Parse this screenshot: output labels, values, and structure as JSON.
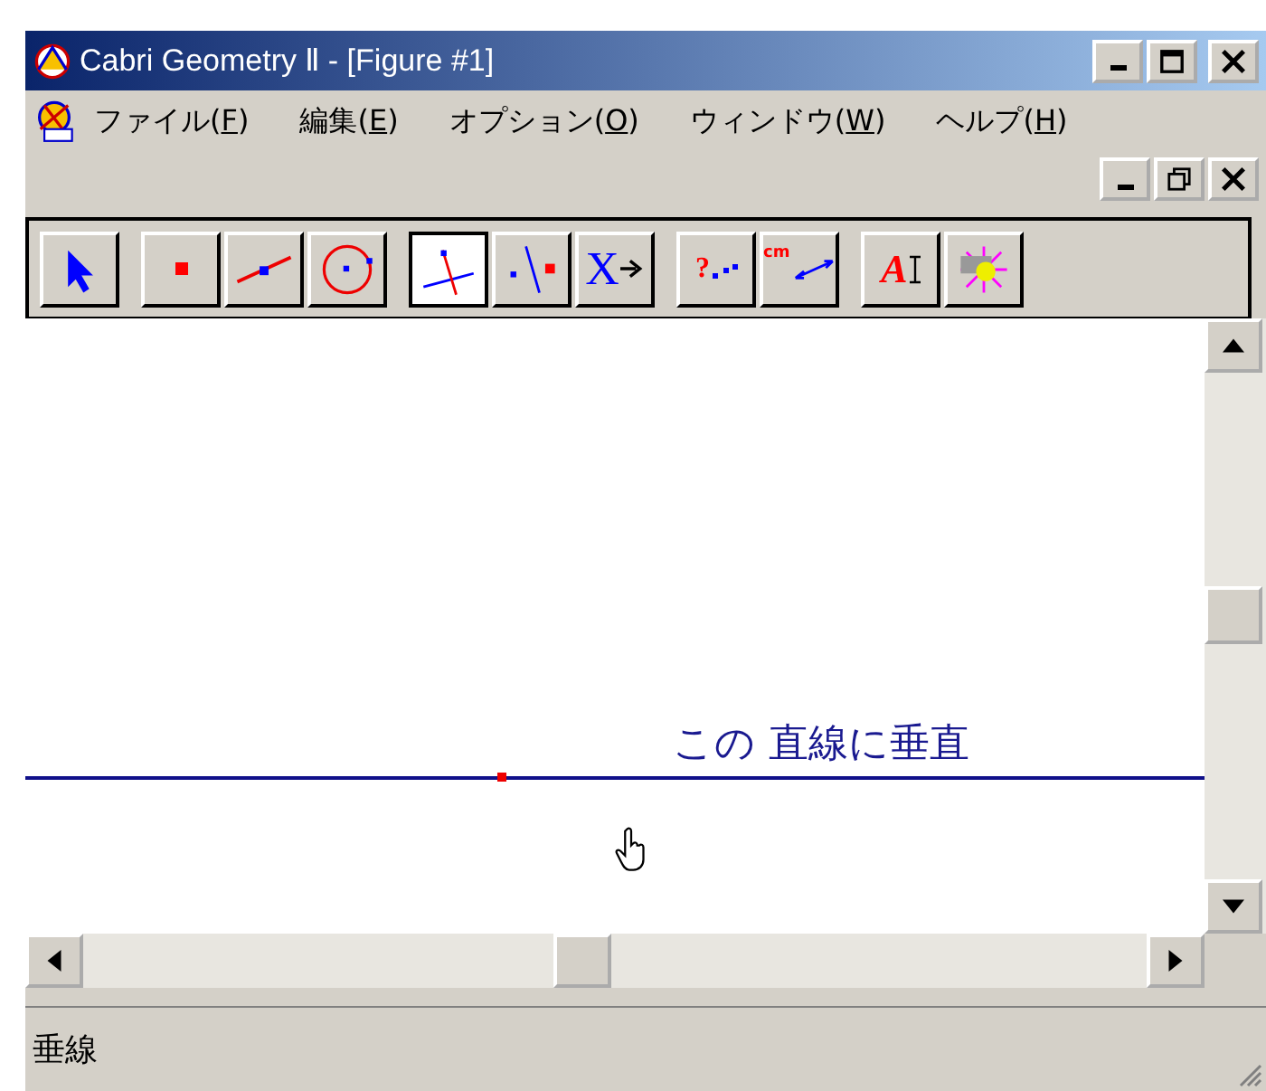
{
  "window": {
    "title": "Cabri Geometry Ⅱ - [Figure #1]"
  },
  "menu": [
    {
      "label": "ファイル(F)"
    },
    {
      "label": "編集(E)"
    },
    {
      "label": "オプション(O)"
    },
    {
      "label": "ウィンドウ(W)"
    },
    {
      "label": "ヘルプ(H)"
    }
  ],
  "toolbar": [
    {
      "kind": "pointer",
      "selected": false
    },
    {
      "kind": "point",
      "selected": false
    },
    {
      "kind": "line",
      "selected": false
    },
    {
      "kind": "circle",
      "selected": false
    },
    {
      "kind": "perpendicular",
      "selected": true
    },
    {
      "kind": "reflect",
      "selected": false
    },
    {
      "kind": "macro",
      "glyph": "X",
      "selected": false
    },
    {
      "kind": "check",
      "glyph": "?",
      "selected": false
    },
    {
      "kind": "measure",
      "glyph": "cm",
      "selected": false
    },
    {
      "kind": "text",
      "glyph": "A",
      "selected": false
    },
    {
      "kind": "display",
      "selected": false
    }
  ],
  "canvas": {
    "hint": "この 直線に垂直"
  },
  "status_bar": {
    "text": "垂線"
  }
}
